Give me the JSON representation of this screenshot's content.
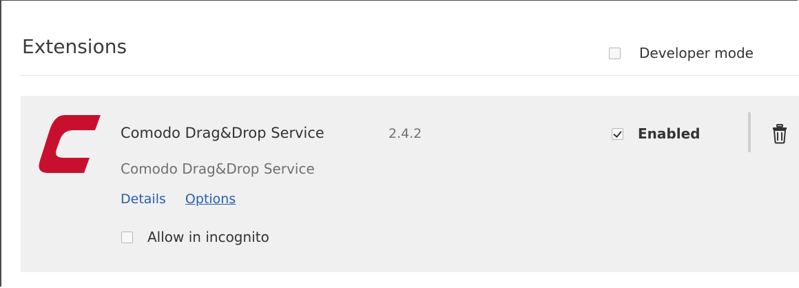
{
  "page": {
    "title": "Extensions"
  },
  "developer_mode": {
    "label": "Developer mode",
    "checked": false
  },
  "extension": {
    "name": "Comodo Drag&Drop Service",
    "version": "2.4.2",
    "description": "Comodo Drag&Drop Service",
    "details_label": "Details",
    "options_label": "Options",
    "incognito_label": "Allow in incognito",
    "incognito_checked": false,
    "enabled_label": "Enabled",
    "enabled_checked": true,
    "logo_icon": "comodo-c-logo",
    "logo_color": "#c8102e",
    "remove_icon": "trash-icon"
  },
  "colors": {
    "card_background": "#f0f0f0",
    "link": "#2a5db0"
  }
}
